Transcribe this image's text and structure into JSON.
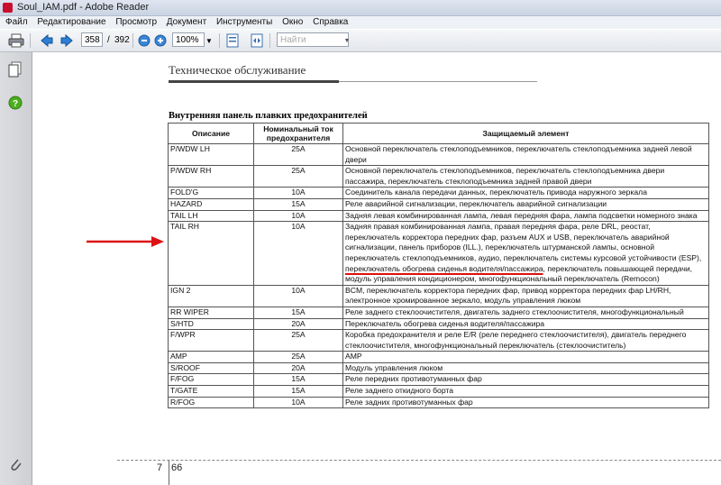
{
  "window": {
    "title": "Soul_IAM.pdf - Adobe Reader"
  },
  "menu": [
    "Файл",
    "Редактирование",
    "Просмотр",
    "Документ",
    "Инструменты",
    "Окно",
    "Справка"
  ],
  "toolbar": {
    "page_current": "358",
    "page_separator": "/",
    "page_total": "392",
    "zoom": "100%",
    "find_placeholder": "Найти"
  },
  "doc": {
    "header": "Техническое обслуживание",
    "subheading": "Внутренняя панель плавких предохранителей",
    "columns": [
      "Описание",
      "Номинальный ток предохранителя",
      "Защищаемый элемент"
    ],
    "rows": [
      {
        "name": "P/WDW LH",
        "rating": "25A",
        "desc": "Основной переключатель стеклоподъемников, переключатель стеклоподъемника задней левой двери"
      },
      {
        "name": "P/WDW RH",
        "rating": "25A",
        "desc": "Основной переключатель стеклоподъемников, переключатель стеклоподъемника двери пассажира, переключатель стеклоподъемника задней правой двери"
      },
      {
        "name": "FOLD'G",
        "rating": "10A",
        "desc": "Соединитель канала передачи данных, переключатель привода наружного зеркала"
      },
      {
        "name": "HAZARD",
        "rating": "15A",
        "desc": "Реле аварийной сигнализации, переключатель аварийной сигнализации"
      },
      {
        "name": "TAIL LH",
        "rating": "10A",
        "desc": "Задняя левая комбинированная лампа, левая передняя фара, лампа подсветки номерного знака"
      },
      {
        "name": "TAIL RH",
        "rating": "10A",
        "desc_pre": "Задняя правая комбинированная лампа, правая передняя фара, реле DRL, реостат, переключатель корректора передних фар, разъем AUX и USB, переключатель аварийной сигнализации, панель приборов (ILL.), переключатель штурманской лампы, основной переключатель стеклоподъемников, аудио, переключатель системы курсовой устойчивости (ESP), ",
        "desc_highlight": "переключатель обогрева сиденья водителя/пассажира",
        "desc_post": ", переключатель повышающей передачи, модуль управления кондиционером, многофункциональный переключатель (Remocon)"
      },
      {
        "name": "IGN 2",
        "rating": "10A",
        "desc": "BCM, переключатель корректора передних фар, привод корректора передних фар LH/RH, электронное хромированное зеркало, модуль управления люком"
      },
      {
        "name": "RR WIPER",
        "rating": "15A",
        "desc": "Реле заднего стеклоочистителя, двигатель заднего стеклоочистителя, многофункциональный"
      },
      {
        "name": "S/HTD",
        "rating": "20A",
        "desc": "Переключатель обогрева сиденья водителя/пассажира"
      },
      {
        "name": "F/WPR",
        "rating": "25A",
        "desc": "Коробка предохранителя и реле E/R (реле переднего стеклоочистителя), двигатель переднего стеклоочистителя, многофункциональный переключатель (стеклоочиститель)"
      },
      {
        "name": "AMP",
        "rating": "25A",
        "desc": "AMP"
      },
      {
        "name": "S/ROOF",
        "rating": "20A",
        "desc": "Модуль управления люком"
      },
      {
        "name": "F/FOG",
        "rating": "15A",
        "desc": "Реле передних противотуманных фар"
      },
      {
        "name": "T/GATE",
        "rating": "15A",
        "desc": "Реле заднего откидного борта"
      },
      {
        "name": "R/FOG",
        "rating": "10A",
        "desc": "Реле задних противотуманных фар"
      }
    ],
    "page_chapter": "7",
    "page_number": "66"
  },
  "colors": {
    "annotation_red": "#dd1111",
    "help_green": "#4caf1e",
    "nav_blue": "#2d7fd6"
  },
  "icons": [
    "app-pdf-icon",
    "print-icon",
    "prev-page-icon",
    "next-page-icon",
    "zoom-out-icon",
    "zoom-in-icon",
    "fit-page-icon",
    "fit-width-icon",
    "pages-icon",
    "help-icon",
    "attachment-icon",
    "red-arrow-annotation"
  ]
}
